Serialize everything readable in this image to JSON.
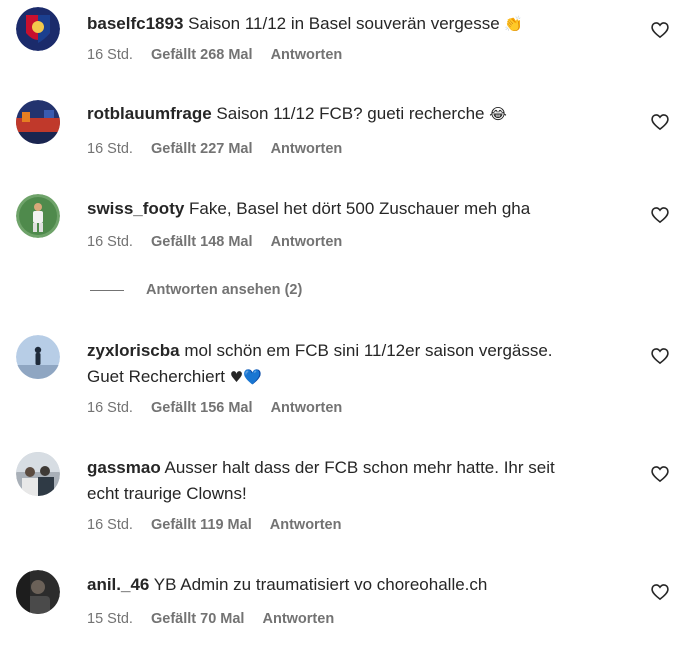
{
  "comments": [
    {
      "username": "baselfc1893",
      "text": "Saison 11/12 in Basel souverän vergesse",
      "emoji": "👏",
      "time": "16 Std.",
      "likes": "Gefällt 268 Mal",
      "reply": "Antworten",
      "avatar_icon": "fc-basel-crest-avatar"
    },
    {
      "username": "rotblauumfrage",
      "text": "Saison 11/12 FCB? gueti recherche",
      "emoji": "😂",
      "time": "16 Std.",
      "likes": "Gefällt 227 Mal",
      "reply": "Antworten",
      "avatar_icon": "crowd-flag-avatar"
    },
    {
      "username": "swiss_footy",
      "text": "Fake, Basel het dört 500 Zuschauer meh gha",
      "time": "16 Std.",
      "likes": "Gefällt 148 Mal",
      "reply": "Antworten",
      "avatar_icon": "football-player-avatar"
    },
    {
      "username": "zyxloriscba",
      "text": "mol schön em FCB sini 11/12er saison vergässe.",
      "text2": "Guet Recherchiert",
      "emoji_a": "♥",
      "emoji_b": "💙",
      "time": "16 Std.",
      "likes": "Gefällt 156 Mal",
      "reply": "Antworten",
      "avatar_icon": "person-silhouette-avatar"
    },
    {
      "username": "gassmao",
      "text": "Ausser halt dass der FCB schon mehr hatte. Ihr seit",
      "text2": "echt traurige Clowns!",
      "time": "16 Std.",
      "likes": "Gefällt 119 Mal",
      "reply": "Antworten",
      "avatar_icon": "group-photo-avatar"
    },
    {
      "username": "anil._46",
      "text": "YB Admin zu traumatisiert vo choreohalle.ch",
      "time": "15 Std.",
      "likes": "Gefällt 70 Mal",
      "reply": "Antworten",
      "avatar_icon": "dark-photo-avatar"
    }
  ],
  "view_replies": "Antworten ansehen (2)",
  "icons": {
    "like": "heart-outline-icon"
  },
  "colors": {
    "text": "#262626",
    "secondary": "#737373",
    "background": "#ffffff"
  }
}
